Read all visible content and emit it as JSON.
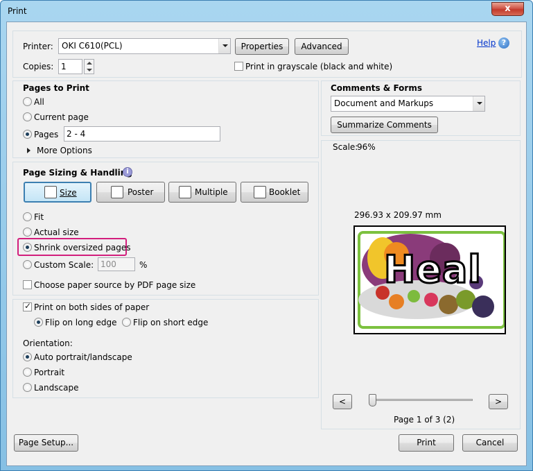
{
  "window": {
    "title": "Print",
    "close_glyph": "x"
  },
  "printer": {
    "label": "Printer:",
    "selected": "OKI C610(PCL)",
    "properties_label": "Properties",
    "advanced_label": "Advanced",
    "help_label": "Help",
    "help_glyph": "?",
    "copies_label": "Copies:",
    "copies_value": "1",
    "grayscale_label": "Print in grayscale (black and white)",
    "grayscale_checked": false
  },
  "pages_to_print": {
    "title": "Pages to Print",
    "all_label": "All",
    "current_label": "Current page",
    "pages_label": "Pages",
    "pages_value": "2 - 4",
    "more_options_label": "More Options"
  },
  "page_sizing": {
    "title": "Page Sizing & Handling",
    "info_glyph": "i",
    "size_label": "Size",
    "poster_label": "Poster",
    "multiple_label": "Multiple",
    "booklet_label": "Booklet",
    "fit_label": "Fit",
    "actual_label": "Actual size",
    "shrink_label": "Shrink oversized pages",
    "custom_label": "Custom Scale:",
    "custom_value": "100",
    "percent": "%",
    "paper_source_label": "Choose paper source by PDF page size",
    "highlight_color": "#d21e7c"
  },
  "duplex": {
    "both_sides_label": "Print on both sides of paper",
    "long_edge_label": "Flip on long edge",
    "short_edge_label": "Flip on short edge",
    "orientation_label": "Orientation:",
    "auto_label": "Auto portrait/landscape",
    "portrait_label": "Portrait",
    "landscape_label": "Landscape"
  },
  "comments_forms": {
    "title": "Comments & Forms",
    "selected": "Document and Markups",
    "summarize_label": "Summarize Comments"
  },
  "preview": {
    "scale_label": "Scale:",
    "scale_value": "96%",
    "dimensions": "296.93 x 209.97 mm",
    "banner_text": "Heal",
    "prev_glyph": "<",
    "next_glyph": ">",
    "page_indicator": "Page 1 of 3 (2)",
    "slider_level": 0
  },
  "footer": {
    "page_setup_label": "Page Setup...",
    "print_label": "Print",
    "cancel_label": "Cancel"
  }
}
